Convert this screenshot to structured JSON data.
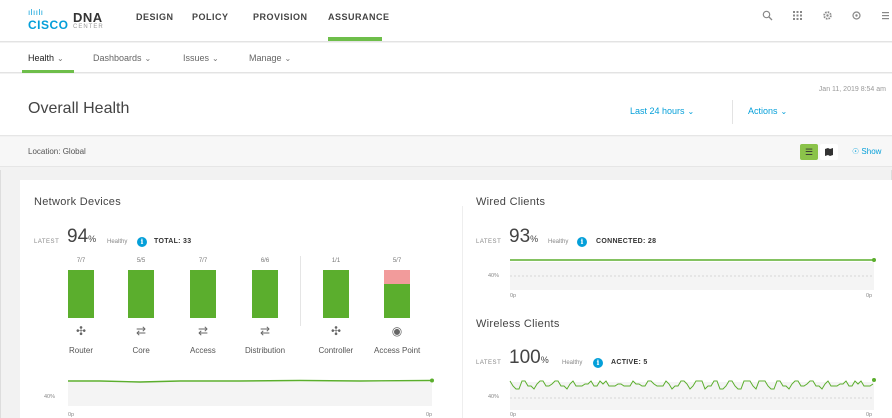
{
  "brand": {
    "bars": "ılıılı",
    "company": "CISCO",
    "product": "DNA",
    "product_sub": "CENTER"
  },
  "topnav": [
    "DESIGN",
    "POLICY",
    "PROVISION",
    "ASSURANCE"
  ],
  "topnav_active": "ASSURANCE",
  "subnav": [
    "Health",
    "Dashboards",
    "Issues",
    "Manage"
  ],
  "subnav_active": "Health",
  "header": {
    "title": "Overall Health",
    "timestamp": "Jan 11, 2019 8:54 am",
    "time_range": "Last 24 hours",
    "actions": "Actions"
  },
  "location": {
    "label": "Location: Global",
    "show_link": "Show"
  },
  "network_devices": {
    "title": "Network Devices",
    "latest_label": "LATEST",
    "percent": "94",
    "pct_sign": "%",
    "healthy_label": "Healthy",
    "total_label": "TOTAL: 33",
    "chart_axis_label": "40%",
    "chart_x_start": "0p",
    "chart_x_end": "0p",
    "categories": [
      {
        "label": "Router",
        "fraction": "7/7",
        "healthy": 7,
        "total": 7
      },
      {
        "label": "Core",
        "fraction": "5/5",
        "healthy": 5,
        "total": 5
      },
      {
        "label": "Access",
        "fraction": "7/7",
        "healthy": 7,
        "total": 7
      },
      {
        "label": "Distribution",
        "fraction": "6/6",
        "healthy": 6,
        "total": 6
      },
      {
        "label": "Controller",
        "fraction": "1/1",
        "healthy": 1,
        "total": 1
      },
      {
        "label": "Access Point",
        "fraction": "5/7",
        "healthy": 5,
        "total": 7
      }
    ]
  },
  "wired_clients": {
    "title": "Wired Clients",
    "latest_label": "LATEST",
    "percent": "93",
    "pct_sign": "%",
    "healthy_label": "Healthy",
    "connected_label": "CONNECTED: 28",
    "chart_axis_label": "40%",
    "chart_x_start": "0p",
    "chart_x_end": "0p"
  },
  "wireless_clients": {
    "title": "Wireless Clients",
    "latest_label": "LATEST",
    "percent": "100",
    "pct_sign": "%",
    "healthy_label": "Healthy",
    "active_label": "ACTIVE: 5",
    "chart_axis_label": "40%",
    "chart_x_start": "0p",
    "chart_x_end": "0p"
  },
  "colors": {
    "accent_green": "#6ebe4a",
    "healthy_bar": "#5bae2d",
    "unhealthy_bar": "#f29b9b",
    "link_blue": "#049fd9"
  },
  "icons": [
    "search-icon",
    "apps-grid-icon",
    "settings-icon",
    "refresh-icon",
    "menu-icon",
    "info-icon",
    "list-view-icon",
    "map-view-icon",
    "eye-icon"
  ]
}
